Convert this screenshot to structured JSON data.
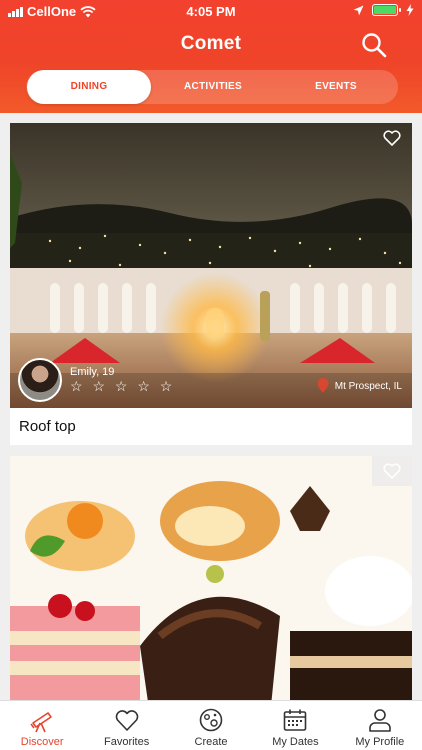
{
  "status_bar": {
    "carrier": "CellOne",
    "time": "4:05 PM"
  },
  "header": {
    "title": "Comet"
  },
  "tabs": [
    {
      "label": "DINING",
      "active": true
    },
    {
      "label": "ACTIVITIES",
      "active": false
    },
    {
      "label": "EVENTS",
      "active": false
    }
  ],
  "cards": [
    {
      "title": "Roof top",
      "user": {
        "name": "Emily, 19",
        "rating": 0,
        "max_rating": 5,
        "stars": "☆ ☆ ☆ ☆ ☆"
      },
      "location": "Mt Prospect, IL"
    },
    {
      "title": ""
    }
  ],
  "tabbar": [
    {
      "label": "Discover",
      "icon": "telescope-icon",
      "active": true
    },
    {
      "label": "Favorites",
      "icon": "heart-icon",
      "active": false
    },
    {
      "label": "Create",
      "icon": "planet-icon",
      "active": false
    },
    {
      "label": "My Dates",
      "icon": "calendar-icon",
      "active": false
    },
    {
      "label": "My Profile",
      "icon": "person-icon",
      "active": false
    }
  ],
  "colors": {
    "accent": "#ef4429",
    "tab_active_text": "#e8432d"
  }
}
